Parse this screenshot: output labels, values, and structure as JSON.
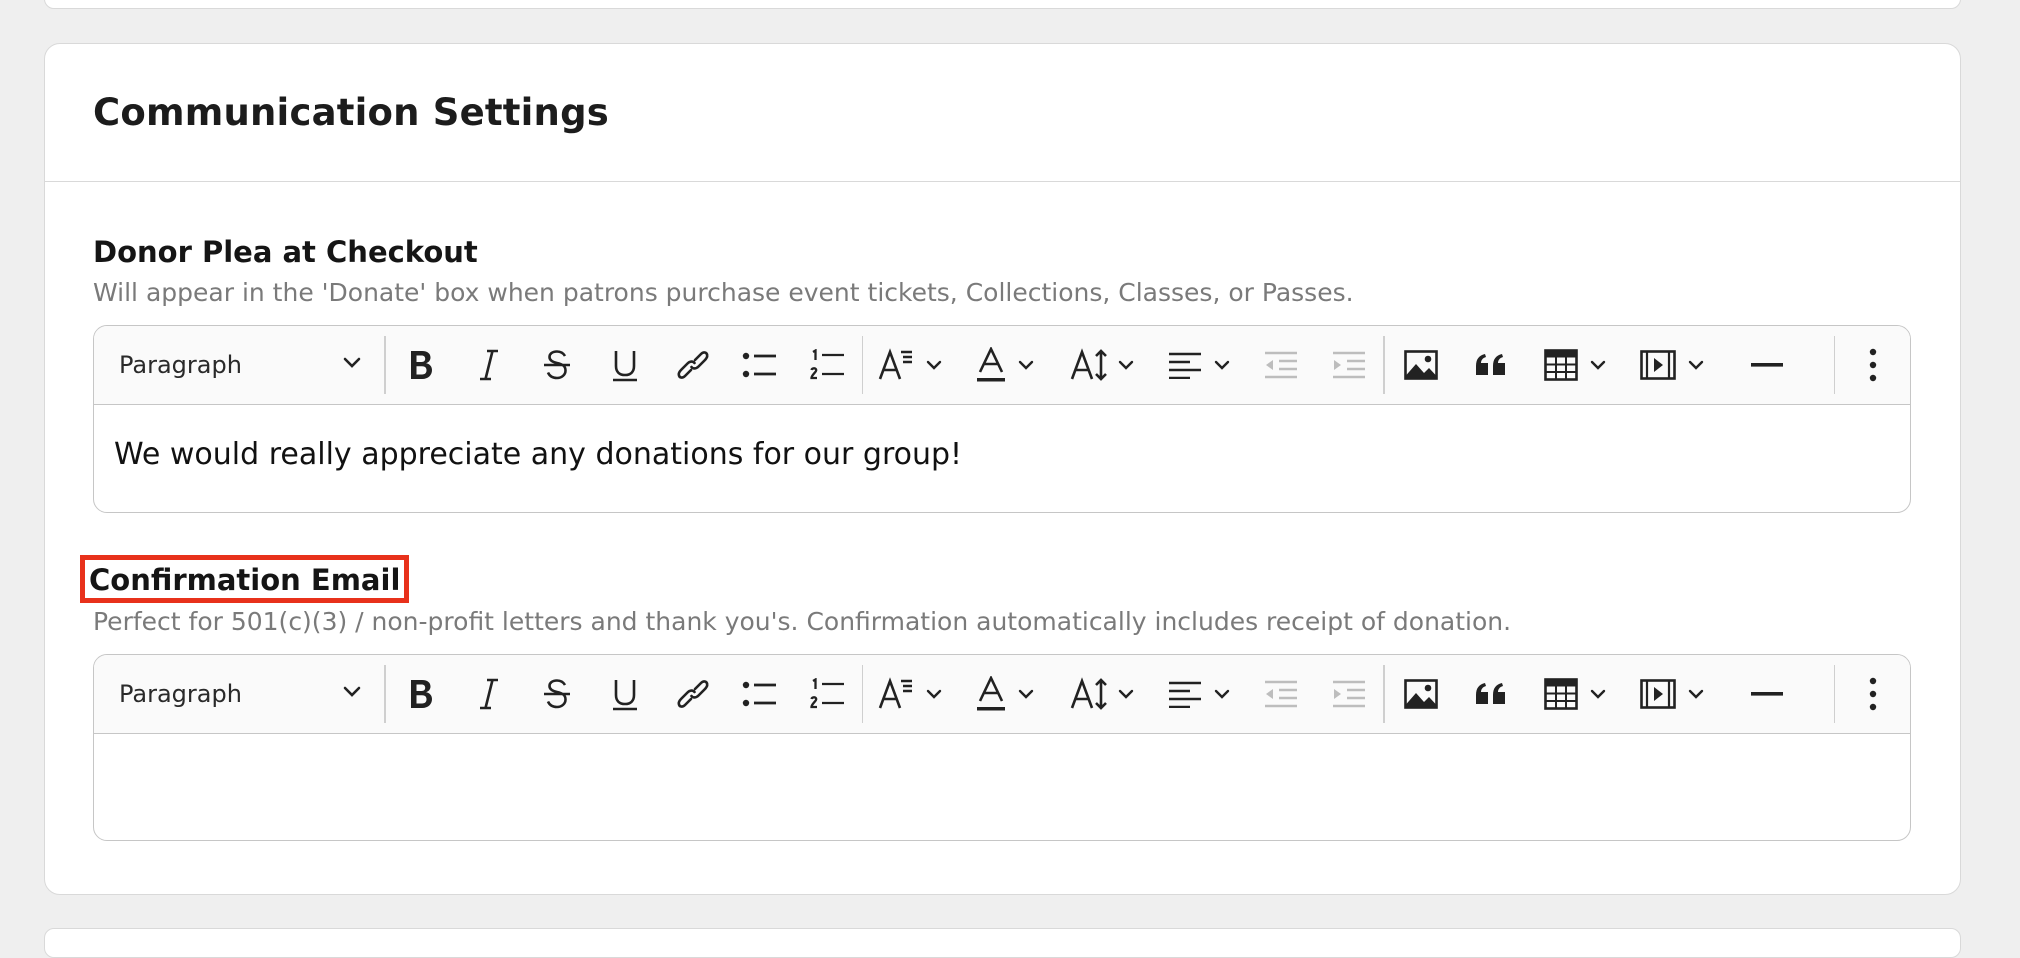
{
  "card": {
    "title": "Communication Settings"
  },
  "sections": [
    {
      "title": "Donor Plea at Checkout",
      "help": "Will appear in the 'Donate' box when patrons purchase event tickets, Collections, Classes, or Passes.",
      "editor": {
        "block_style": "Paragraph",
        "content": "We would really appreciate any donations for our group!"
      }
    },
    {
      "title": "Confirmation Email",
      "help": "Perfect for 501(c)(3) / non-profit letters and thank you's. Confirmation automatically includes receipt of donation.",
      "highlighted": true,
      "editor": {
        "block_style": "Paragraph",
        "content": ""
      }
    }
  ],
  "toolbar_icons": [
    "bold-icon",
    "italic-icon",
    "strikethrough-icon",
    "underline-icon",
    "link-icon",
    "bulleted-list-icon",
    "numbered-list-icon",
    "font-family-icon",
    "font-color-icon",
    "font-size-icon",
    "align-icon",
    "outdent-icon",
    "indent-icon",
    "image-icon",
    "quote-icon",
    "table-icon",
    "media-icon",
    "horizontal-line-icon",
    "more-icon"
  ],
  "colors": {
    "highlight": "#e8311b",
    "page_bg": "#efefef",
    "muted_text": "#7a7a7a"
  }
}
